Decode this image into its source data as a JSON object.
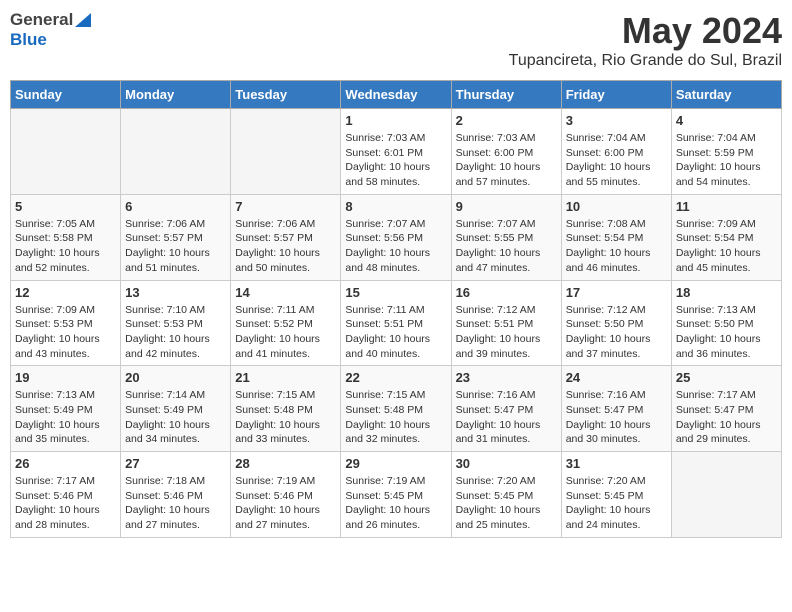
{
  "header": {
    "logo_general": "General",
    "logo_blue": "Blue",
    "month_title": "May 2024",
    "location": "Tupancireta, Rio Grande do Sul, Brazil"
  },
  "days_of_week": [
    "Sunday",
    "Monday",
    "Tuesday",
    "Wednesday",
    "Thursday",
    "Friday",
    "Saturday"
  ],
  "weeks": [
    [
      {
        "day": "",
        "empty": true
      },
      {
        "day": "",
        "empty": true
      },
      {
        "day": "",
        "empty": true
      },
      {
        "day": "1",
        "sunrise": "7:03 AM",
        "sunset": "6:01 PM",
        "daylight": "10 hours and 58 minutes."
      },
      {
        "day": "2",
        "sunrise": "7:03 AM",
        "sunset": "6:00 PM",
        "daylight": "10 hours and 57 minutes."
      },
      {
        "day": "3",
        "sunrise": "7:04 AM",
        "sunset": "6:00 PM",
        "daylight": "10 hours and 55 minutes."
      },
      {
        "day": "4",
        "sunrise": "7:04 AM",
        "sunset": "5:59 PM",
        "daylight": "10 hours and 54 minutes."
      }
    ],
    [
      {
        "day": "5",
        "sunrise": "7:05 AM",
        "sunset": "5:58 PM",
        "daylight": "10 hours and 52 minutes."
      },
      {
        "day": "6",
        "sunrise": "7:06 AM",
        "sunset": "5:57 PM",
        "daylight": "10 hours and 51 minutes."
      },
      {
        "day": "7",
        "sunrise": "7:06 AM",
        "sunset": "5:57 PM",
        "daylight": "10 hours and 50 minutes."
      },
      {
        "day": "8",
        "sunrise": "7:07 AM",
        "sunset": "5:56 PM",
        "daylight": "10 hours and 48 minutes."
      },
      {
        "day": "9",
        "sunrise": "7:07 AM",
        "sunset": "5:55 PM",
        "daylight": "10 hours and 47 minutes."
      },
      {
        "day": "10",
        "sunrise": "7:08 AM",
        "sunset": "5:54 PM",
        "daylight": "10 hours and 46 minutes."
      },
      {
        "day": "11",
        "sunrise": "7:09 AM",
        "sunset": "5:54 PM",
        "daylight": "10 hours and 45 minutes."
      }
    ],
    [
      {
        "day": "12",
        "sunrise": "7:09 AM",
        "sunset": "5:53 PM",
        "daylight": "10 hours and 43 minutes."
      },
      {
        "day": "13",
        "sunrise": "7:10 AM",
        "sunset": "5:53 PM",
        "daylight": "10 hours and 42 minutes."
      },
      {
        "day": "14",
        "sunrise": "7:11 AM",
        "sunset": "5:52 PM",
        "daylight": "10 hours and 41 minutes."
      },
      {
        "day": "15",
        "sunrise": "7:11 AM",
        "sunset": "5:51 PM",
        "daylight": "10 hours and 40 minutes."
      },
      {
        "day": "16",
        "sunrise": "7:12 AM",
        "sunset": "5:51 PM",
        "daylight": "10 hours and 39 minutes."
      },
      {
        "day": "17",
        "sunrise": "7:12 AM",
        "sunset": "5:50 PM",
        "daylight": "10 hours and 37 minutes."
      },
      {
        "day": "18",
        "sunrise": "7:13 AM",
        "sunset": "5:50 PM",
        "daylight": "10 hours and 36 minutes."
      }
    ],
    [
      {
        "day": "19",
        "sunrise": "7:13 AM",
        "sunset": "5:49 PM",
        "daylight": "10 hours and 35 minutes."
      },
      {
        "day": "20",
        "sunrise": "7:14 AM",
        "sunset": "5:49 PM",
        "daylight": "10 hours and 34 minutes."
      },
      {
        "day": "21",
        "sunrise": "7:15 AM",
        "sunset": "5:48 PM",
        "daylight": "10 hours and 33 minutes."
      },
      {
        "day": "22",
        "sunrise": "7:15 AM",
        "sunset": "5:48 PM",
        "daylight": "10 hours and 32 minutes."
      },
      {
        "day": "23",
        "sunrise": "7:16 AM",
        "sunset": "5:47 PM",
        "daylight": "10 hours and 31 minutes."
      },
      {
        "day": "24",
        "sunrise": "7:16 AM",
        "sunset": "5:47 PM",
        "daylight": "10 hours and 30 minutes."
      },
      {
        "day": "25",
        "sunrise": "7:17 AM",
        "sunset": "5:47 PM",
        "daylight": "10 hours and 29 minutes."
      }
    ],
    [
      {
        "day": "26",
        "sunrise": "7:17 AM",
        "sunset": "5:46 PM",
        "daylight": "10 hours and 28 minutes."
      },
      {
        "day": "27",
        "sunrise": "7:18 AM",
        "sunset": "5:46 PM",
        "daylight": "10 hours and 27 minutes."
      },
      {
        "day": "28",
        "sunrise": "7:19 AM",
        "sunset": "5:46 PM",
        "daylight": "10 hours and 27 minutes."
      },
      {
        "day": "29",
        "sunrise": "7:19 AM",
        "sunset": "5:45 PM",
        "daylight": "10 hours and 26 minutes."
      },
      {
        "day": "30",
        "sunrise": "7:20 AM",
        "sunset": "5:45 PM",
        "daylight": "10 hours and 25 minutes."
      },
      {
        "day": "31",
        "sunrise": "7:20 AM",
        "sunset": "5:45 PM",
        "daylight": "10 hours and 24 minutes."
      },
      {
        "day": "",
        "empty": true
      }
    ]
  ]
}
